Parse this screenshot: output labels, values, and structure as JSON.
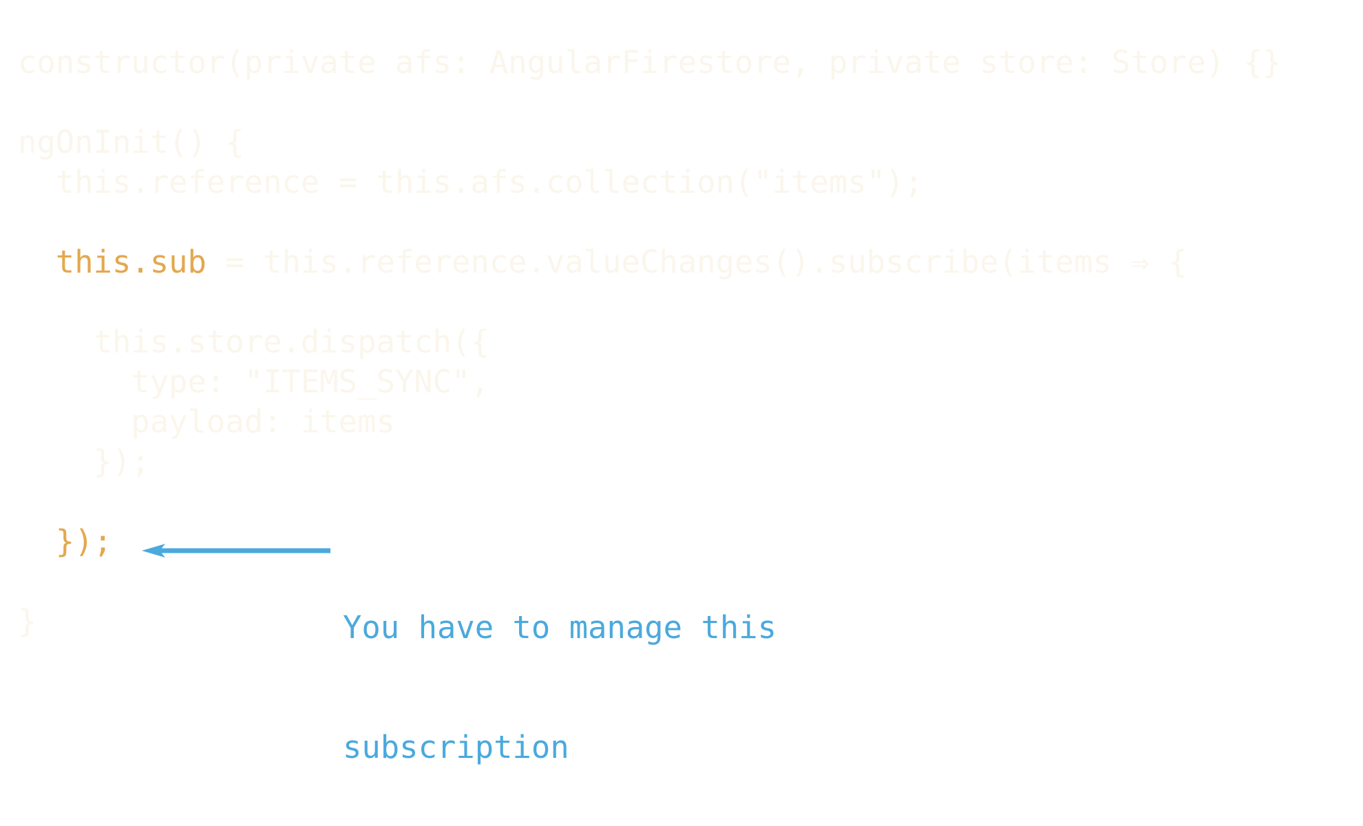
{
  "code": {
    "lines": [
      {
        "before": "constructor(private afs: AngularFirestore, private store: Store) {}",
        "hl": "",
        "after": ""
      },
      {
        "before": "",
        "hl": "",
        "after": ""
      },
      {
        "before": "ngOnInit() {",
        "hl": "",
        "after": ""
      },
      {
        "before": "  this.reference = this.afs.collection(\"items\");",
        "hl": "",
        "after": ""
      },
      {
        "before": "",
        "hl": "",
        "after": ""
      },
      {
        "before": "  ",
        "hl": "this.sub",
        "after": " = this.reference.valueChanges().subscribe(items ⇒ {"
      },
      {
        "before": "",
        "hl": "",
        "after": ""
      },
      {
        "before": "    this.store.dispatch({",
        "hl": "",
        "after": ""
      },
      {
        "before": "      type: \"ITEMS_SYNC\",",
        "hl": "",
        "after": ""
      },
      {
        "before": "      payload: items",
        "hl": "",
        "after": ""
      },
      {
        "before": "    });",
        "hl": "",
        "after": ""
      },
      {
        "before": "",
        "hl": "",
        "after": ""
      },
      {
        "before": "  ",
        "hl": "});",
        "after": ""
      },
      {
        "before": "",
        "hl": "",
        "after": ""
      },
      {
        "before": "}",
        "hl": "",
        "after": ""
      }
    ]
  },
  "annotation": {
    "line1": "You have to manage this",
    "line2": "subscription"
  },
  "colors": {
    "faded_code": "#fbf6ec",
    "highlight": "#e3a84e",
    "annotation": "#4aa9dd",
    "background": "#ffffff"
  }
}
